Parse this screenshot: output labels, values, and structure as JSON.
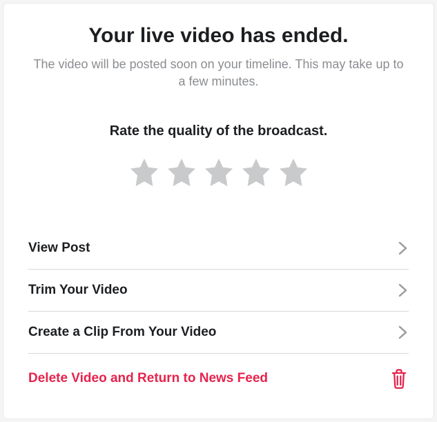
{
  "header": {
    "title": "Your live video has ended.",
    "subtitle": "The video will be posted soon on your timeline. This may take up to a few minutes."
  },
  "rating": {
    "label": "Rate the quality of the broadcast.",
    "count": 5,
    "value": 0
  },
  "menu": {
    "items": [
      {
        "label": "View Post"
      },
      {
        "label": "Trim Your Video"
      },
      {
        "label": "Create a Clip From Your Video"
      }
    ]
  },
  "delete": {
    "label": "Delete Video and Return to News Feed"
  },
  "colors": {
    "danger": "#e5234d",
    "muted": "#8a8d91",
    "star_inactive": "#c8cacc"
  }
}
